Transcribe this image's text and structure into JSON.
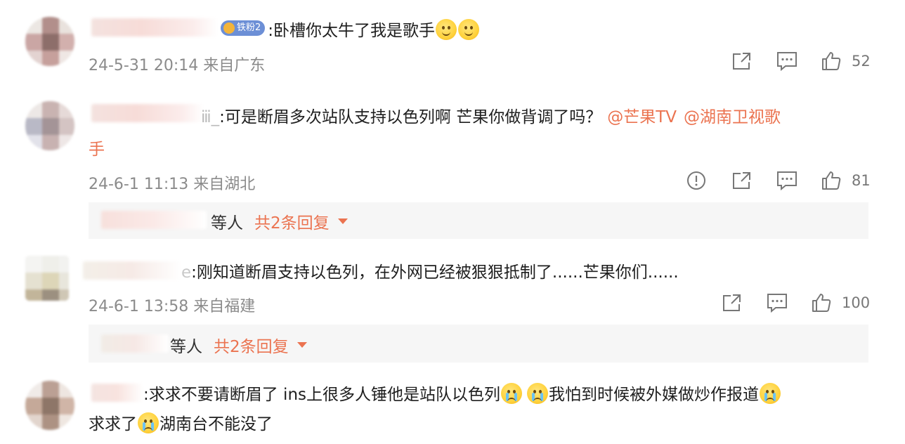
{
  "comments": [
    {
      "badge": "铁粉2",
      "text": ":卧槽你太牛了我是歌手",
      "time": "24-5-31 20:14 来自广东",
      "likes": "52"
    },
    {
      "name_tail": "ⅲ_",
      "text": ":可是断眉多次站队支持以色列啊 芒果你做背调了吗？",
      "mention1": "@芒果TV",
      "mention2": "@湖南卫视歌",
      "text_line2": "手",
      "time": "24-6-1 11:13 来自湖北",
      "likes": "81",
      "replies": {
        "who": "等人",
        "link": "共2条回复"
      }
    },
    {
      "name_tail": "e",
      "text": ":刚知道断眉支持以色列，在外网已经被狠狠抵制了......芒果你们......",
      "time": "24-6-1 13:58 来自福建",
      "likes": "100",
      "replies": {
        "who": "等人",
        "link": "共2条回复"
      }
    },
    {
      "text": ":求求不要请断眉了 ins上很多人锤他是站队以色列",
      "text_mid": "我怕到时候被外媒做炒作报道",
      "text_line2a": "求求了",
      "text_line2b": "湖南台不能没了"
    }
  ],
  "icons": [
    "share-icon",
    "comment-icon",
    "like-icon",
    "report-icon"
  ],
  "colors": {
    "mention": "#eb7350",
    "meta": "#8b8b8b"
  }
}
